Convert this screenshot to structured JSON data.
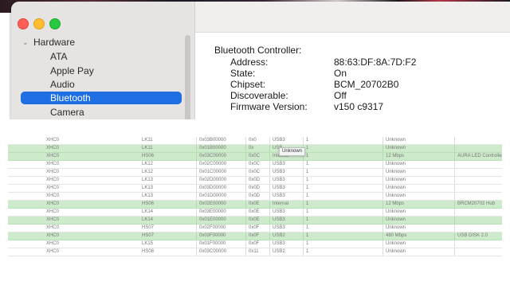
{
  "sidebar": {
    "group_label": "Hardware",
    "items": [
      {
        "label": "ATA"
      },
      {
        "label": "Apple Pay"
      },
      {
        "label": "Audio"
      },
      {
        "label": "Bluetooth",
        "selected": true
      },
      {
        "label": "Camera"
      }
    ]
  },
  "content": {
    "heading": "Bluetooth Controller:",
    "properties": [
      {
        "key": "Address:",
        "value": "88:63:DF:8A:7D:F2"
      },
      {
        "key": "State:",
        "value": "On"
      },
      {
        "key": "Chipset:",
        "value": "BCM_20702B0"
      },
      {
        "key": "Discoverable:",
        "value": "Off"
      },
      {
        "key": "Firmware Version:",
        "value": "v150 c9317"
      }
    ]
  },
  "usb_table": {
    "tooltip": "Unknown",
    "rows": [
      {
        "cells": [
          "XHC0",
          "LK11",
          "0x03B00000",
          "0x0",
          "USB3",
          "1",
          "Unknown",
          ""
        ],
        "highlighted": false
      },
      {
        "cells": [
          "XHC0",
          "LK11",
          "0x01B00000",
          "0x",
          "USB",
          "1",
          "Unknown",
          ""
        ],
        "highlighted": true
      },
      {
        "cells": [
          "XHC0",
          "HS06",
          "0x03C00000",
          "0x0C",
          "Internal",
          "1",
          "12 Mbps",
          "AURA LED Controller"
        ],
        "highlighted": true
      },
      {
        "cells": [
          "XHC0",
          "LK12",
          "0x02C00000",
          "0x0C",
          "USB3",
          "1",
          "Unknown",
          ""
        ],
        "highlighted": false
      },
      {
        "cells": [
          "XHC0",
          "LK12",
          "0x01C00000",
          "0x0C",
          "USB3",
          "1",
          "Unknown",
          ""
        ],
        "highlighted": false
      },
      {
        "cells": [
          "XHC0",
          "LK13",
          "0x02D00000",
          "0x0D",
          "USB3",
          "1",
          "Unknown",
          ""
        ],
        "highlighted": false
      },
      {
        "cells": [
          "XHC0",
          "LK13",
          "0x03D00000",
          "0x0D",
          "USB3",
          "1",
          "Unknown",
          ""
        ],
        "highlighted": false
      },
      {
        "cells": [
          "XHC0",
          "LK13",
          "0x01D00000",
          "0x0D",
          "USB3",
          "1",
          "Unknown",
          ""
        ],
        "highlighted": false
      },
      {
        "cells": [
          "XHC0",
          "HS06",
          "0x02E00000",
          "0x0E",
          "Internal",
          "1",
          "12 Mbps",
          "BRCM20702 Hub"
        ],
        "highlighted": true
      },
      {
        "cells": [
          "XHC0",
          "LK14",
          "0x03E00000",
          "0x0E",
          "USB3",
          "1",
          "Unknown",
          ""
        ],
        "highlighted": false
      },
      {
        "cells": [
          "XHC0",
          "LK14",
          "0x01E00000",
          "0x0E",
          "USB3",
          "1",
          "Unknown",
          ""
        ],
        "highlighted": true
      },
      {
        "cells": [
          "XHC0",
          "HS07",
          "0x02F00000",
          "0x0F",
          "USB3",
          "1",
          "Unknown",
          ""
        ],
        "highlighted": false
      },
      {
        "cells": [
          "XHC0",
          "HS07",
          "0x03F00000",
          "0x0F",
          "USB2",
          "1",
          "480 Mbps",
          "USB DISK 2.0"
        ],
        "highlighted": true
      },
      {
        "cells": [
          "XHC0",
          "LK15",
          "0x01F00000",
          "0x0F",
          "USB3",
          "1",
          "Unknown",
          ""
        ],
        "highlighted": false
      },
      {
        "cells": [
          "XHC0",
          "HS08",
          "0x03C00000",
          "0x11",
          "USB2",
          "1",
          "Unknown",
          ""
        ],
        "highlighted": false
      }
    ]
  }
}
